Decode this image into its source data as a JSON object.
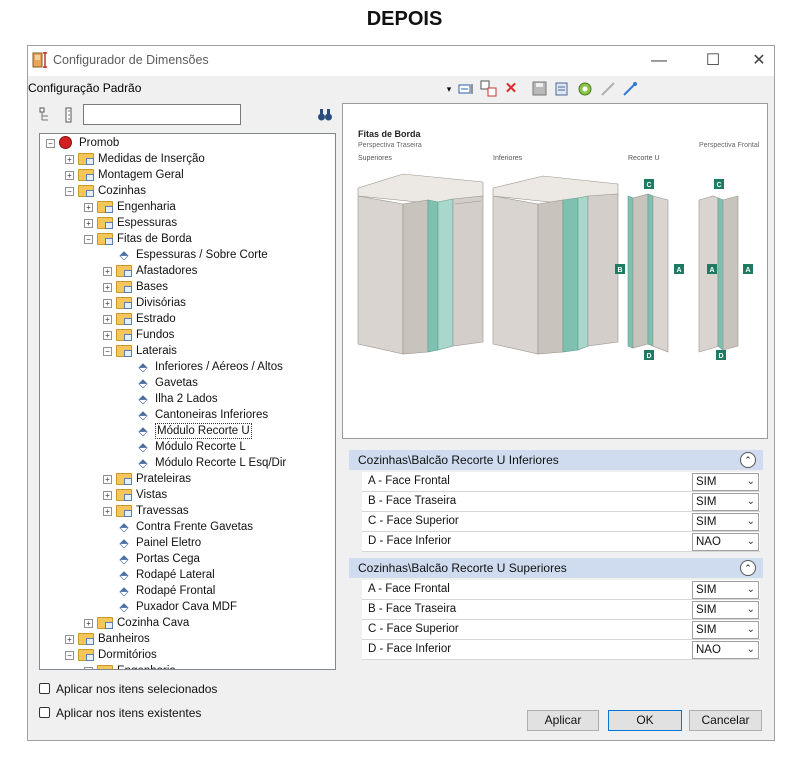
{
  "page_heading": "DEPOIS",
  "window": {
    "title": "Configurador de Dimensões",
    "controls": {
      "minimize": "—",
      "maximize": "☐",
      "close": "✕"
    }
  },
  "toolbar": {
    "config_label": "Configuração Padrão",
    "icons": [
      "dropdown-arrow",
      "edit-dimension-icon",
      "copy-icon",
      "delete-icon",
      "save-icon",
      "properties-icon",
      "settings-icon",
      "disconnect-icon",
      "connect-icon"
    ]
  },
  "search": {
    "value": "",
    "placeholder": ""
  },
  "tree": {
    "items": [
      {
        "label": "Promob",
        "level": 0,
        "expander": "minus",
        "icon": "promob"
      },
      {
        "label": "Medidas de Inserção",
        "level": 1,
        "expander": "plus",
        "icon": "folder"
      },
      {
        "label": "Montagem Geral",
        "level": 1,
        "expander": "plus",
        "icon": "folder"
      },
      {
        "label": "Cozinhas",
        "level": 1,
        "expander": "minus",
        "icon": "folder"
      },
      {
        "label": "Engenharia",
        "level": 2,
        "expander": "plus",
        "icon": "folder"
      },
      {
        "label": "Espessuras",
        "level": 2,
        "expander": "plus",
        "icon": "folder"
      },
      {
        "label": "Fitas de Borda",
        "level": 2,
        "expander": "minus",
        "icon": "folder"
      },
      {
        "label": "Espessuras / Sobre Corte",
        "level": 3,
        "expander": "",
        "icon": "tag"
      },
      {
        "label": "Afastadores",
        "level": 3,
        "expander": "plus",
        "icon": "folder"
      },
      {
        "label": "Bases",
        "level": 3,
        "expander": "plus",
        "icon": "folder"
      },
      {
        "label": "Divisórias",
        "level": 3,
        "expander": "plus",
        "icon": "folder"
      },
      {
        "label": "Estrado",
        "level": 3,
        "expander": "plus",
        "icon": "folder"
      },
      {
        "label": "Fundos",
        "level": 3,
        "expander": "plus",
        "icon": "folder"
      },
      {
        "label": "Laterais",
        "level": 3,
        "expander": "minus",
        "icon": "folder"
      },
      {
        "label": "Inferiores / Aéreos / Altos",
        "level": 4,
        "expander": "",
        "icon": "tag"
      },
      {
        "label": "Gavetas",
        "level": 4,
        "expander": "",
        "icon": "tag"
      },
      {
        "label": "Ilha 2 Lados",
        "level": 4,
        "expander": "",
        "icon": "tag"
      },
      {
        "label": "Cantoneiras Inferiores",
        "level": 4,
        "expander": "",
        "icon": "tag"
      },
      {
        "label": "Módulo Recorte U",
        "level": 4,
        "expander": "",
        "icon": "tag",
        "selected": true
      },
      {
        "label": "Módulo Recorte L",
        "level": 4,
        "expander": "",
        "icon": "tag"
      },
      {
        "label": "Módulo Recorte L Esq/Dir",
        "level": 4,
        "expander": "",
        "icon": "tag"
      },
      {
        "label": "Prateleiras",
        "level": 3,
        "expander": "plus",
        "icon": "folder"
      },
      {
        "label": "Vistas",
        "level": 3,
        "expander": "plus",
        "icon": "folder"
      },
      {
        "label": "Travessas",
        "level": 3,
        "expander": "plus",
        "icon": "folder"
      },
      {
        "label": "Contra Frente Gavetas",
        "level": 3,
        "expander": "",
        "icon": "tag"
      },
      {
        "label": "Painel Eletro",
        "level": 3,
        "expander": "",
        "icon": "tag"
      },
      {
        "label": "Portas Cega",
        "level": 3,
        "expander": "",
        "icon": "tag"
      },
      {
        "label": "Rodapé Lateral",
        "level": 3,
        "expander": "",
        "icon": "tag"
      },
      {
        "label": "Rodapé Frontal",
        "level": 3,
        "expander": "",
        "icon": "tag"
      },
      {
        "label": "Puxador Cava MDF",
        "level": 3,
        "expander": "",
        "icon": "tag"
      },
      {
        "label": "Cozinha Cava",
        "level": 2,
        "expander": "plus",
        "icon": "folder"
      },
      {
        "label": "Banheiros",
        "level": 1,
        "expander": "plus",
        "icon": "folder"
      },
      {
        "label": "Dormitórios",
        "level": 1,
        "expander": "minus",
        "icon": "folder"
      },
      {
        "label": "Engenharia",
        "level": 2,
        "expander": "plus",
        "icon": "folder"
      }
    ]
  },
  "preview": {
    "title": "Fitas de Borda",
    "subtitle_left": "Perspectiva Traseira",
    "subtitle_right": "Perspectiva Frontal",
    "labels": [
      "Superiores",
      "Inferiores",
      "Recorte U"
    ],
    "edge_letters": {
      "a": "A",
      "b": "B",
      "c": "C",
      "d": "D"
    },
    "colors": {
      "panel": "#d9d4cf",
      "panel_dark": "#bfb8b1",
      "edge": "#7fc1b0",
      "edge_label": "#1f7a62"
    }
  },
  "groups": [
    {
      "title": "Cozinhas\\Balcão Recorte U Inferiores",
      "toggle": "⌃",
      "rows": [
        {
          "name": "A - Face Frontal",
          "value": "SIM"
        },
        {
          "name": "B - Face Traseira",
          "value": "SIM"
        },
        {
          "name": "C - Face Superior",
          "value": "SIM"
        },
        {
          "name": "D - Face Inferior",
          "value": "NAO"
        }
      ]
    },
    {
      "title": "Cozinhas\\Balcão Recorte U Superiores",
      "toggle": "⌃",
      "rows": [
        {
          "name": "A - Face Frontal",
          "value": "SIM"
        },
        {
          "name": "B - Face Traseira",
          "value": "SIM"
        },
        {
          "name": "C - Face Superior",
          "value": "SIM"
        },
        {
          "name": "D - Face Inferior",
          "value": "NAO"
        }
      ]
    }
  ],
  "options": {
    "apply_selected": "Aplicar nos itens selecionados",
    "apply_existing": "Aplicar nos itens existentes"
  },
  "buttons": {
    "apply": "Aplicar",
    "ok": "OK",
    "cancel": "Cancelar"
  },
  "glyphs": {
    "chevron_down": "⌄",
    "dropdown": "▾",
    "binoculars": "🔍",
    "plus": "+",
    "minus": "−"
  }
}
